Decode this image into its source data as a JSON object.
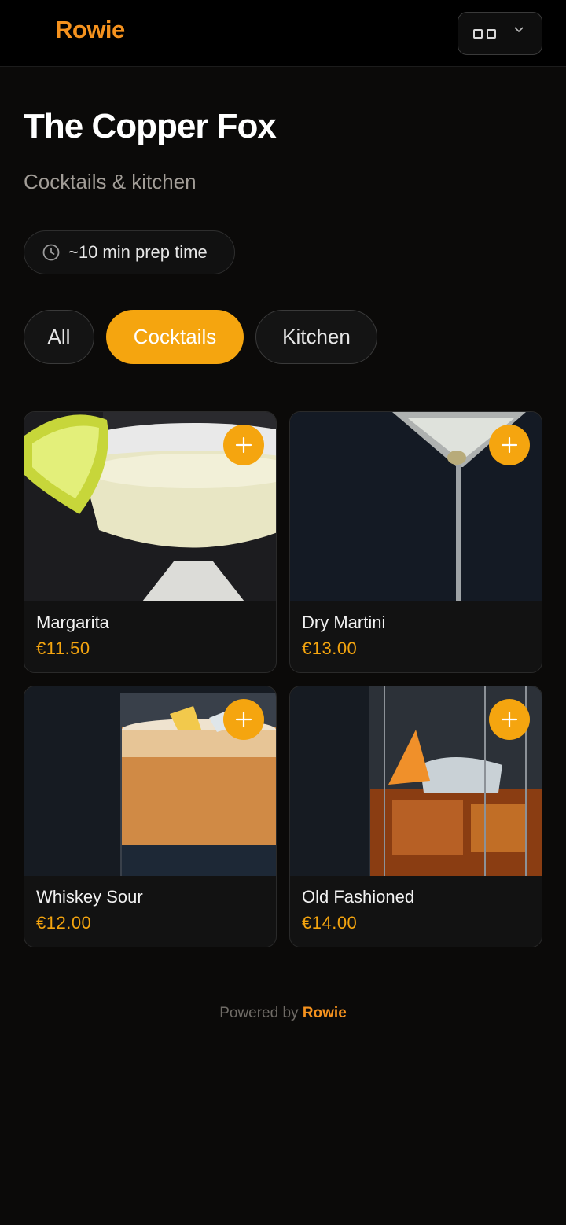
{
  "header": {
    "logo": "Rowie",
    "language_icon": "flag-icon",
    "dropdown_icon": "chevron-down-icon"
  },
  "venue": {
    "name": "The Copper Fox",
    "subtitle": "Cocktails & kitchen",
    "prep_time": "~10 min prep time",
    "prep_icon": "clock-icon"
  },
  "tabs": [
    {
      "label": "All",
      "active": false
    },
    {
      "label": "Cocktails",
      "active": true
    },
    {
      "label": "Kitchen",
      "active": false
    }
  ],
  "items": [
    {
      "name": "Margarita",
      "price": "€11.50"
    },
    {
      "name": "Dry Martini",
      "price": "€13.00"
    },
    {
      "name": "Whiskey Sour",
      "price": "€12.00"
    },
    {
      "name": "Old Fashioned",
      "price": "€14.00"
    }
  ],
  "footer": {
    "prefix": "Powered by",
    "brand": "Rowie"
  },
  "colors": {
    "accent": "#f5a50f",
    "brand": "#f5921e",
    "background": "#0b0a09"
  }
}
